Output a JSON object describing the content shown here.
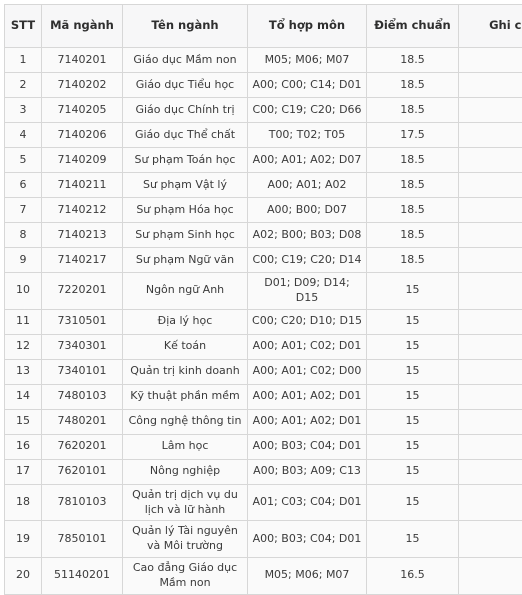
{
  "table": {
    "columns": [
      {
        "key": "stt",
        "label": "STT"
      },
      {
        "key": "ma",
        "label": "Mã ngành"
      },
      {
        "key": "ten",
        "label": "Tên ngành"
      },
      {
        "key": "to",
        "label": "Tổ hợp môn"
      },
      {
        "key": "diem",
        "label": "Điểm chuẩn"
      },
      {
        "key": "ghi",
        "label": "Ghi chú"
      }
    ],
    "rows": [
      {
        "stt": "1",
        "ma": "7140201",
        "ten": "Giáo dục Mầm non",
        "to": "M05; M06; M07",
        "diem": "18.5",
        "ghi": ""
      },
      {
        "stt": "2",
        "ma": "7140202",
        "ten": "Giáo dục Tiểu học",
        "to": "A00; C00; C14; D01",
        "diem": "18.5",
        "ghi": ""
      },
      {
        "stt": "3",
        "ma": "7140205",
        "ten": "Giáo dục Chính trị",
        "to": "C00; C19; C20; D66",
        "diem": "18.5",
        "ghi": ""
      },
      {
        "stt": "4",
        "ma": "7140206",
        "ten": "Giáo dục Thể chất",
        "to": "T00; T02; T05",
        "diem": "17.5",
        "ghi": ""
      },
      {
        "stt": "5",
        "ma": "7140209",
        "ten": "Sư phạm Toán học",
        "to": "A00; A01; A02; D07",
        "diem": "18.5",
        "ghi": ""
      },
      {
        "stt": "6",
        "ma": "7140211",
        "ten": "Sư phạm Vật lý",
        "to": "A00; A01; A02",
        "diem": "18.5",
        "ghi": ""
      },
      {
        "stt": "7",
        "ma": "7140212",
        "ten": "Sư phạm Hóa học",
        "to": "A00; B00; D07",
        "diem": "18.5",
        "ghi": ""
      },
      {
        "stt": "8",
        "ma": "7140213",
        "ten": "Sư phạm Sinh học",
        "to": "A02; B00; B03; D08",
        "diem": "18.5",
        "ghi": ""
      },
      {
        "stt": "9",
        "ma": "7140217",
        "ten": "Sư phạm Ngữ văn",
        "to": "C00; C19; C20; D14",
        "diem": "18.5",
        "ghi": ""
      },
      {
        "stt": "10",
        "ma": "7220201",
        "ten": "Ngôn ngữ Anh",
        "to": "D01; D09; D14; D15",
        "diem": "15",
        "ghi": ""
      },
      {
        "stt": "11",
        "ma": "7310501",
        "ten": "Địa lý học",
        "to": "C00; C20; D10; D15",
        "diem": "15",
        "ghi": ""
      },
      {
        "stt": "12",
        "ma": "7340301",
        "ten": "Kế toán",
        "to": "A00; A01; C02; D01",
        "diem": "15",
        "ghi": ""
      },
      {
        "stt": "13",
        "ma": "7340101",
        "ten": "Quản trị kinh doanh",
        "to": "A00; A01; C02; D00",
        "diem": "15",
        "ghi": ""
      },
      {
        "stt": "14",
        "ma": "7480103",
        "ten": "Kỹ thuật phần mềm",
        "to": "A00; A01; A02; D01",
        "diem": "15",
        "ghi": ""
      },
      {
        "stt": "15",
        "ma": "7480201",
        "ten": "Công nghệ thông tin",
        "to": "A00; A01; A02; D01",
        "diem": "15",
        "ghi": ""
      },
      {
        "stt": "16",
        "ma": "7620201",
        "ten": "Lâm học",
        "to": "A00; B03; C04; D01",
        "diem": "15",
        "ghi": ""
      },
      {
        "stt": "17",
        "ma": "7620101",
        "ten": "Nông nghiệp",
        "to": "A00; B03; A09; C13",
        "diem": "15",
        "ghi": ""
      },
      {
        "stt": "18",
        "ma": "7810103",
        "ten": "Quản trị dịch vụ du lịch và lữ hành",
        "to": "A01; C03; C04; D01",
        "diem": "15",
        "ghi": ""
      },
      {
        "stt": "19",
        "ma": "7850101",
        "ten": "Quản lý Tài nguyên và Môi trường",
        "to": "A00; B03; C04; D01",
        "diem": "15",
        "ghi": ""
      },
      {
        "stt": "20",
        "ma": "51140201",
        "ten": "Cao đẳng Giáo dục Mầm non",
        "to": "M05; M06; M07",
        "diem": "16.5",
        "ghi": ""
      }
    ]
  },
  "colors": {
    "border": "#d7d7d7",
    "header_bg": "#f7f7f8",
    "row_bg": "#fafafa",
    "text": "#3b3b3b",
    "page_bg": "#ffffff"
  }
}
